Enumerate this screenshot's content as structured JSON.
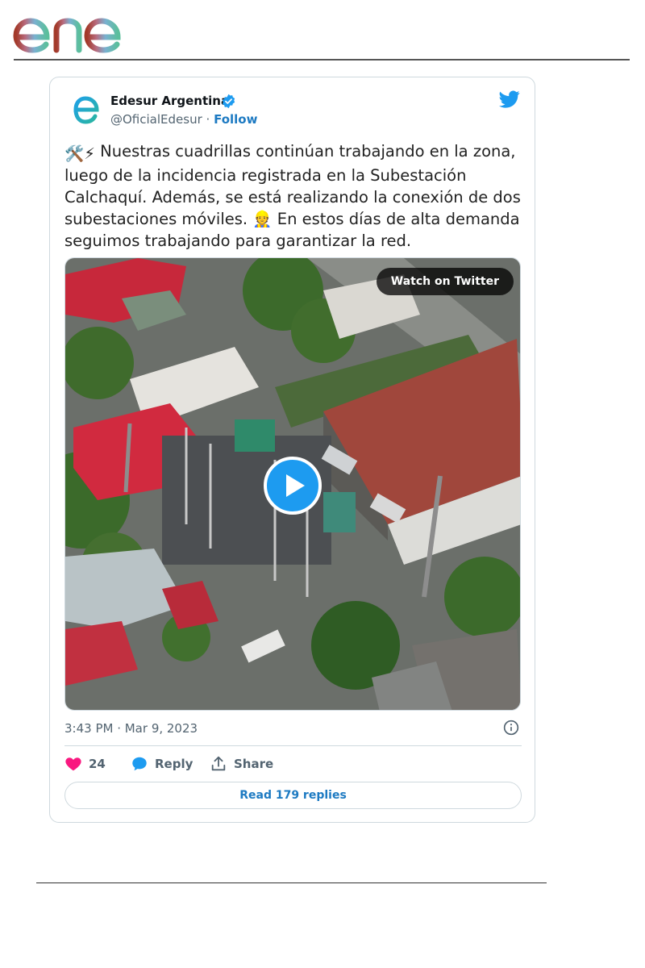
{
  "brand": {
    "logo_text": "enel"
  },
  "tweet": {
    "author_name": "Edesur Argentina",
    "handle": "@OficialEdesur",
    "separator": " · ",
    "follow_label": "Follow",
    "emoji_lead": "🛠️⚡",
    "text_part1": " Nuestras cuadrillas continúan trabajando en la zona, luego de la incidencia registrada en la Subestación Calchaquí. Además, se está realizando la conexión de dos subestaciones móviles. ",
    "emoji_mid": "👷",
    "text_part2": " En estos días de alta demanda seguimos trabajando para garantizar la red.",
    "media": {
      "watch_label": "Watch on Twitter"
    },
    "timestamp": "3:43 PM · Mar 9, 2023",
    "likes": "24",
    "reply_label": "Reply",
    "share_label": "Share",
    "read_replies_label": "Read 179 replies"
  },
  "colors": {
    "accent": "#1d7ac2",
    "like": "#f91880",
    "twitter": "#1d9bf0"
  }
}
